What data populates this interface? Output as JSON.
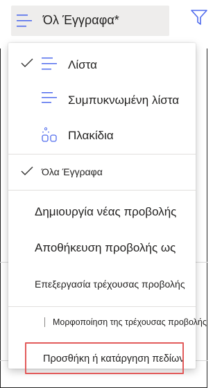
{
  "header": {
    "view_title": "Όλ Έγγραφα*"
  },
  "menu": {
    "layouts": [
      {
        "label": "Λίστα",
        "checked": true,
        "icon": "list-icon"
      },
      {
        "label": "Συμπυκνωμένη λίστα",
        "checked": false,
        "icon": "compact-list-icon"
      },
      {
        "label": "Πλακίδια",
        "checked": false,
        "icon": "tiles-icon"
      }
    ],
    "views": [
      {
        "label": "Όλα Έγγραφα",
        "checked": true
      }
    ],
    "actions": {
      "create_view": "Δημιουργία νέας προβολής",
      "save_view_as": "Αποθήκευση προβολής ως",
      "edit_view": "Επεξεργασία τρέχουσας προβολής",
      "format_view": "Μορφοποίηση της τρέχουσας προβολής",
      "add_remove_columns": "Προσθήκη ή κατάργηση πεδίων"
    }
  },
  "colors": {
    "accent": "#4f6bed",
    "highlight_border": "#e25a5a"
  }
}
